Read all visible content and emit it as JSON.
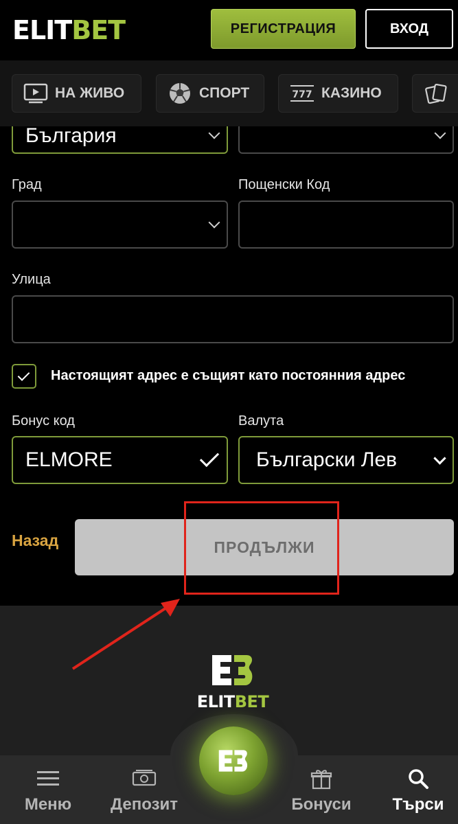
{
  "header": {
    "logo_white": "ELIT",
    "logo_green": "BET",
    "register_label": "РЕГИСТРАЦИЯ",
    "login_label": "ВХОД"
  },
  "nav": {
    "items": [
      {
        "label": "НА ЖИВО",
        "icon": "live-video-icon"
      },
      {
        "label": "СПОРТ",
        "icon": "soccer-ball-icon"
      },
      {
        "label": "КАЗИНО",
        "icon": "slot-777-icon"
      },
      {
        "label": "",
        "icon": "playing-cards-icon"
      }
    ]
  },
  "form": {
    "country_value": "България",
    "city_label": "Град",
    "postcode_label": "Пощенски Код",
    "street_label": "Улица",
    "same_address_label": "Настоящият адрес е същият като постоянния адрес",
    "bonus_label": "Бонус код",
    "bonus_value": "ELMORE",
    "currency_label": "Валута",
    "currency_value": "Български Лев",
    "back_label": "Назад",
    "continue_label": "ПРОДЪЛЖИ"
  },
  "footer": {
    "logo_white": "ELIT",
    "logo_green": "BET"
  },
  "bottom_nav": {
    "items": [
      {
        "label": "Меню",
        "icon": "hamburger-menu-icon"
      },
      {
        "label": "Депозит",
        "icon": "cash-icon"
      },
      {
        "label": "Бонуси",
        "icon": "gift-icon"
      },
      {
        "label": "Търси",
        "icon": "search-icon"
      }
    ]
  },
  "colors": {
    "accent_green": "#a4c641",
    "back_gold": "#d9a441",
    "highlight_red": "#e0241b"
  }
}
